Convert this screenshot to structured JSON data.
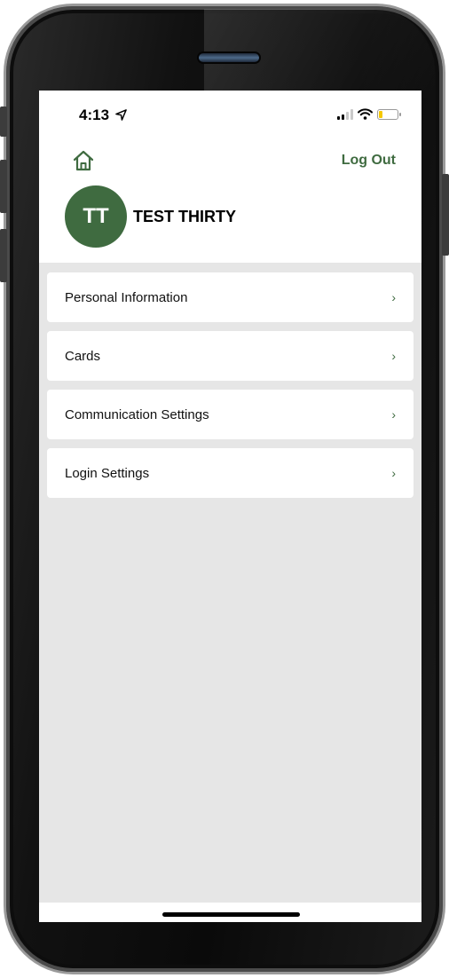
{
  "status_bar": {
    "time": "4:13",
    "location_icon": "location-arrow-icon",
    "signal_icon": "cellular-signal-icon",
    "wifi_icon": "wifi-icon",
    "battery_icon": "battery-icon",
    "battery_level": 0.2,
    "battery_color": "#f5c800"
  },
  "header": {
    "home_icon": "home-icon",
    "logout_label": "Log Out"
  },
  "profile": {
    "initials": "TT",
    "name": "TEST THIRTY",
    "avatar_color": "#3f6b40"
  },
  "menu": {
    "items": [
      {
        "label": "Personal Information",
        "chevron": "›"
      },
      {
        "label": "Cards",
        "chevron": "›"
      },
      {
        "label": "Communication Settings",
        "chevron": "›"
      },
      {
        "label": "Login Settings",
        "chevron": "›"
      }
    ]
  },
  "colors": {
    "accent": "#3f6b40",
    "background": "#e6e6e6"
  }
}
